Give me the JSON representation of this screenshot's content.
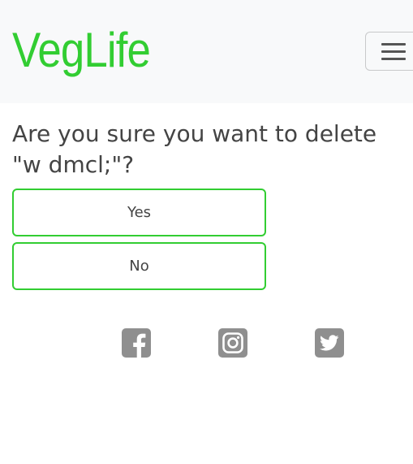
{
  "navbar": {
    "brand": "VegLife",
    "brand_color": "#32cd32",
    "toggler_icon": "hamburger-menu-icon"
  },
  "dialog": {
    "question_line1": "Are you sure you want to delete",
    "question_line2": "\"w dmcl;\"?",
    "yes_label": "Yes",
    "no_label": "No",
    "button_border_color": "#32cd32"
  },
  "social": {
    "icons": [
      "facebook-icon",
      "instagram-icon",
      "twitter-icon"
    ],
    "icon_color": "#8f8f8f"
  }
}
